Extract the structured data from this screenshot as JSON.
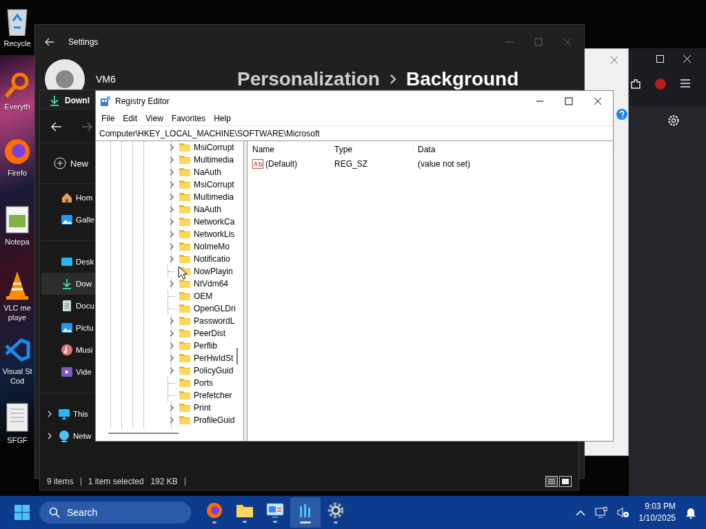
{
  "desktop": {
    "icons": [
      {
        "kind": "recycle",
        "lines": [
          "Recycle"
        ]
      },
      {
        "kind": "search",
        "lines": [
          "Everyth"
        ]
      },
      {
        "kind": "firefox",
        "lines": [
          "Firefo"
        ]
      },
      {
        "kind": "notepad",
        "lines": [
          "Notepa"
        ]
      },
      {
        "kind": "vlc",
        "lines": [
          "VLC me",
          "playe"
        ]
      },
      {
        "kind": "vscode",
        "lines": [
          "Visual St",
          "Cod"
        ]
      },
      {
        "kind": "document",
        "lines": [
          "SFGF"
        ]
      }
    ]
  },
  "settings_window": {
    "title": "Settings",
    "user_name": "VM6",
    "breadcrumb": [
      "Personalization",
      "Background"
    ]
  },
  "explorer_window": {
    "tab_title": "Downl",
    "new_button": "New",
    "nav": [
      {
        "kind": "home",
        "label": "Hom",
        "selected": false
      },
      {
        "kind": "gallery",
        "label": "Galle",
        "selected": false
      },
      {
        "kind": "desktop",
        "label": "Desk",
        "selected": false
      },
      {
        "kind": "downloads",
        "label": "Dow",
        "selected": true
      },
      {
        "kind": "documents",
        "label": "Docu",
        "selected": false
      },
      {
        "kind": "pictures",
        "label": "Pictu",
        "selected": false
      },
      {
        "kind": "music",
        "label": "Musi",
        "selected": false
      },
      {
        "kind": "videos",
        "label": "Vide",
        "selected": false
      },
      {
        "kind": "pc",
        "label": "This",
        "selected": false
      },
      {
        "kind": "network",
        "label": "Netw",
        "selected": false
      }
    ],
    "status_bar": {
      "item_count": "9 items",
      "selection": "1 item selected",
      "size": "192 KB"
    }
  },
  "registry_editor": {
    "title": "Registry Editor",
    "menu": [
      "File",
      "Edit",
      "View",
      "Favorites",
      "Help"
    ],
    "address": "Computer\\HKEY_LOCAL_MACHINE\\SOFTWARE\\Microsoft",
    "tree": [
      {
        "label": "MsiCorrupt",
        "has_children": true
      },
      {
        "label": "Multimedia",
        "has_children": true
      },
      {
        "label": "NaAuth",
        "has_children": true
      },
      {
        "label": "MsiCorrupt",
        "has_children": true
      },
      {
        "label": "Multimedia",
        "has_children": true
      },
      {
        "label": "NaAuth",
        "has_children": true
      },
      {
        "label": "NetworkCa",
        "has_children": true
      },
      {
        "label": "NetworkLis",
        "has_children": true
      },
      {
        "label": "NoImeMo",
        "has_children": true
      },
      {
        "label": "Notificatio",
        "has_children": true
      },
      {
        "label": "NowPlayin",
        "has_children": false
      },
      {
        "label": "NtVdm64",
        "has_children": true
      },
      {
        "label": "OEM",
        "has_children": false
      },
      {
        "label": "OpenGLDri",
        "has_children": false
      },
      {
        "label": "PasswordL",
        "has_children": true
      },
      {
        "label": "PeerDist",
        "has_children": true
      },
      {
        "label": "Perflib",
        "has_children": true
      },
      {
        "label": "PerHwIdSt",
        "has_children": true
      },
      {
        "label": "PolicyGuid",
        "has_children": true
      },
      {
        "label": "Ports",
        "has_children": false
      },
      {
        "label": "Prefetcher",
        "has_children": false
      },
      {
        "label": "Print",
        "has_children": true
      },
      {
        "label": "ProfileGuid",
        "has_children": true
      }
    ],
    "columns": [
      "Name",
      "Type",
      "Data"
    ],
    "values": [
      {
        "name": "(Default)",
        "type": "REG_SZ",
        "data": "(value not set)"
      }
    ]
  },
  "taskbar": {
    "search_placeholder": "Search",
    "apps": [
      {
        "kind": "firefox",
        "active": false
      },
      {
        "kind": "folder",
        "active": false
      },
      {
        "kind": "control-panel",
        "active": false
      },
      {
        "kind": "registry",
        "active": true
      },
      {
        "kind": "gear",
        "active": false
      }
    ],
    "time": "9:03 PM",
    "date": "1/10/2025"
  }
}
